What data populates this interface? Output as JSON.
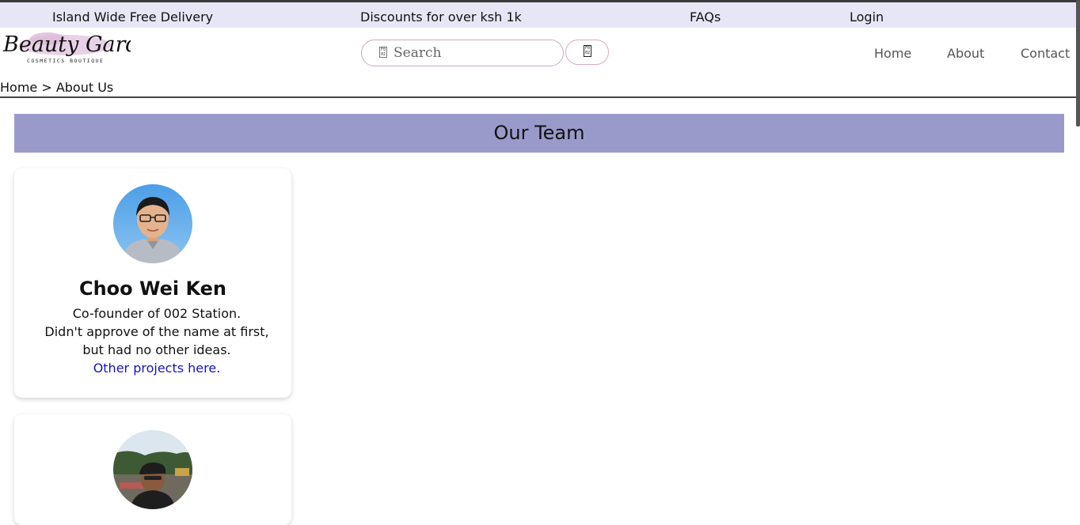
{
  "topbar": {
    "delivery": "Island Wide Free Delivery",
    "discounts": "Discounts for over ksh 1k",
    "faqs": "FAQs",
    "login": "Login",
    "background": "#e6e6f7"
  },
  "header": {
    "logo_text": "Beauty Garden",
    "logo_subtext": "COSMETICS BOUTIQUE",
    "search": {
      "placeholder": "Search"
    },
    "search_icon": "search-icon",
    "nav": [
      {
        "label": "Home"
      },
      {
        "label": "About"
      },
      {
        "label": "Contact"
      }
    ]
  },
  "breadcrumb": "Home > About Us",
  "team": {
    "heading": "Our Team",
    "heading_color": "#9a9aca",
    "members": [
      {
        "name": "Choo Wei Ken",
        "desc_lines": [
          "Co-founder of 002 Station.",
          "Didn't approve of the name at first,",
          "but had no other ideas."
        ],
        "link": "Other projects here."
      },
      {
        "name": "",
        "desc_lines": [],
        "link": ""
      }
    ]
  },
  "colors": {
    "link": "#1515c8",
    "border_pink": "#d8a8c4"
  }
}
